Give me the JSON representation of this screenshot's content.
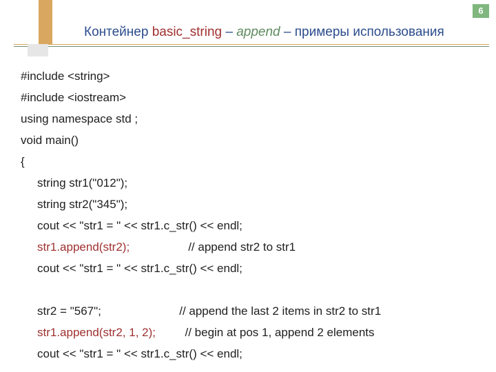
{
  "page_number": "6",
  "title": {
    "part1": "Контейнер ",
    "part2": "basic_string",
    "part3": " – ",
    "part4": "append",
    "part5": " – примеры использования"
  },
  "code": {
    "l1": "#include <string>",
    "l2": "#include <iostream>",
    "l3": "using namespace std ;",
    "l4": "void main()",
    "l5": "{",
    "l6": "string str1(\"012\");",
    "l7": "string str2(\"345\");",
    "l8": "cout << \"str1 = \" << str1.c_str() << endl;",
    "l9a": "str1.append(str2);",
    "l9b": "                  // append str2 to str1",
    "l10": "cout << \"str1 = \" << str1.c_str() << endl;",
    "blank": " ",
    "l11": "str2 = \"567\";                        // append the last 2 items in str2 to str1",
    "l12a": "str1.append(str2, 1, 2);",
    "l12b": "         // begin at pos 1, append 2 elements",
    "l13": "cout << \"str1 = \" << str1.c_str() << endl;"
  }
}
